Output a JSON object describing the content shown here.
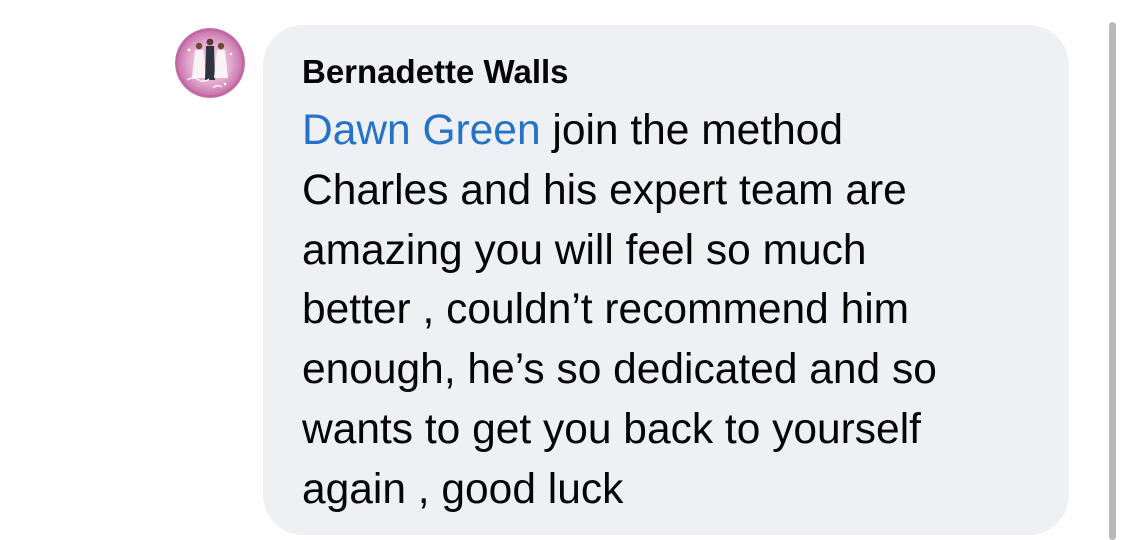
{
  "comment": {
    "author": "Bernadette Walls",
    "mention": "Dawn Green",
    "text_lines": [
      " join the method",
      "Charles and his expert team are",
      "amazing you will feel so much",
      "better , couldn’t recommend him",
      "enough, he’s so dedicated and so",
      "wants to get you back to yourself",
      "again , good luck"
    ]
  },
  "colors": {
    "bubble": "#eef0f4",
    "mention": "#2473c7",
    "text": "#050505",
    "avatar_ring": "#d77fb8"
  }
}
